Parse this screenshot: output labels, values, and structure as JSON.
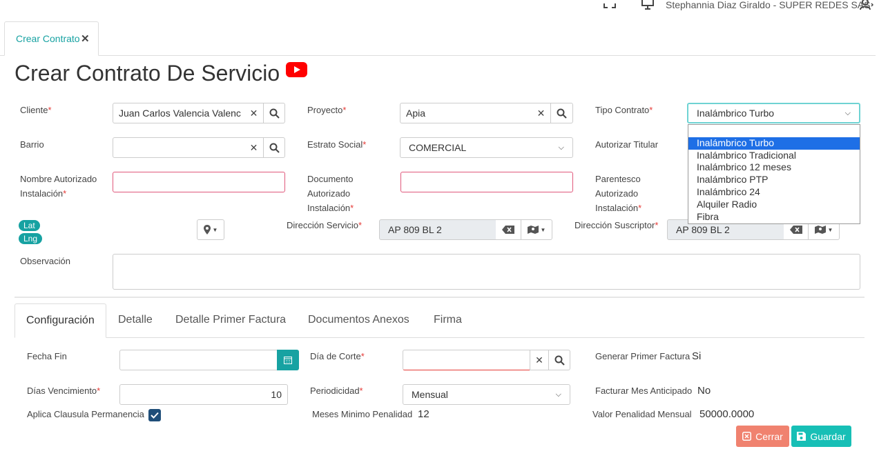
{
  "topbar": {
    "user": "Stephannia Diaz Giraldo - SUPER REDES SAS"
  },
  "tabs_top": [
    {
      "label": "Crear Contrato"
    }
  ],
  "page": {
    "title": "Crear Contrato De Servicio"
  },
  "form": {
    "cliente": {
      "label": "Cliente",
      "value": "Juan Carlos Valencia Valenc"
    },
    "proyecto": {
      "label": "Proyecto",
      "value": "Apia"
    },
    "tipo_contrato": {
      "label": "Tipo Contrato",
      "value": "Inalámbrico Turbo",
      "options": [
        "",
        "Inalámbrico Turbo",
        "Inalámbrico Tradicional",
        "Inalámbrico 12 meses",
        "Inalámbrico PTP",
        "Inalámbrico 24",
        "Alquiler Radio",
        "Fibra"
      ]
    },
    "barrio": {
      "label": "Barrio",
      "value": ""
    },
    "estrato": {
      "label": "Estrato Social",
      "value": "COMERCIAL"
    },
    "autorizar_titular": {
      "label": "Autorizar Titular"
    },
    "nombre_autorizado": {
      "label_1": "Nombre Autorizado",
      "label_2": "Instalación"
    },
    "documento_autorizado": {
      "label_1": "Documento",
      "label_2": "Autorizado",
      "label_3": "Instalación"
    },
    "parentesco": {
      "label_1": "Parentesco",
      "label_2": "Autorizado",
      "label_3": "Instalación"
    },
    "lat_label": "Lat",
    "lng_label": "Lng",
    "direccion_servicio": {
      "label": "Dirección Servicio",
      "value": "AP 809 BL 2"
    },
    "direccion_suscriptor": {
      "label": "Dirección Suscriptor",
      "value": "AP 809 BL 2"
    },
    "observacion": {
      "label": "Observación",
      "value": ""
    }
  },
  "tabs": [
    {
      "label": "Configuración"
    },
    {
      "label": "Detalle"
    },
    {
      "label": "Detalle Primer Factura"
    },
    {
      "label": "Documentos Anexos"
    },
    {
      "label": "Firma"
    }
  ],
  "config": {
    "fecha_fin": {
      "label": "Fecha Fin",
      "value": ""
    },
    "dia_corte": {
      "label": "Día de Corte",
      "value": ""
    },
    "generar_primer_factura": {
      "label": "Generar Primer Factura",
      "value": "Si"
    },
    "dias_vencimiento": {
      "label": "Días Vencimiento",
      "value": "10"
    },
    "periodicidad": {
      "label": "Periodicidad",
      "value": "Mensual"
    },
    "facturar_mes_anticipado": {
      "label": "Facturar Mes Anticipado",
      "value": "No"
    },
    "aplica_clausula": {
      "label": "Aplica Clausula Permanencia",
      "checked": true
    },
    "meses_minimo": {
      "label": "Meses Minimo Penalidad",
      "value": "12"
    },
    "valor_penalidad": {
      "label": "Valor Penalidad Mensual",
      "value": "50000.0000"
    }
  },
  "actions": {
    "cerrar": "Cerrar",
    "guardar": "Guardar"
  },
  "colors": {
    "teal": "#17a2a2",
    "close_btn": "#f0826f",
    "required": "#e53935",
    "selected_option": "#1e6fe6"
  }
}
